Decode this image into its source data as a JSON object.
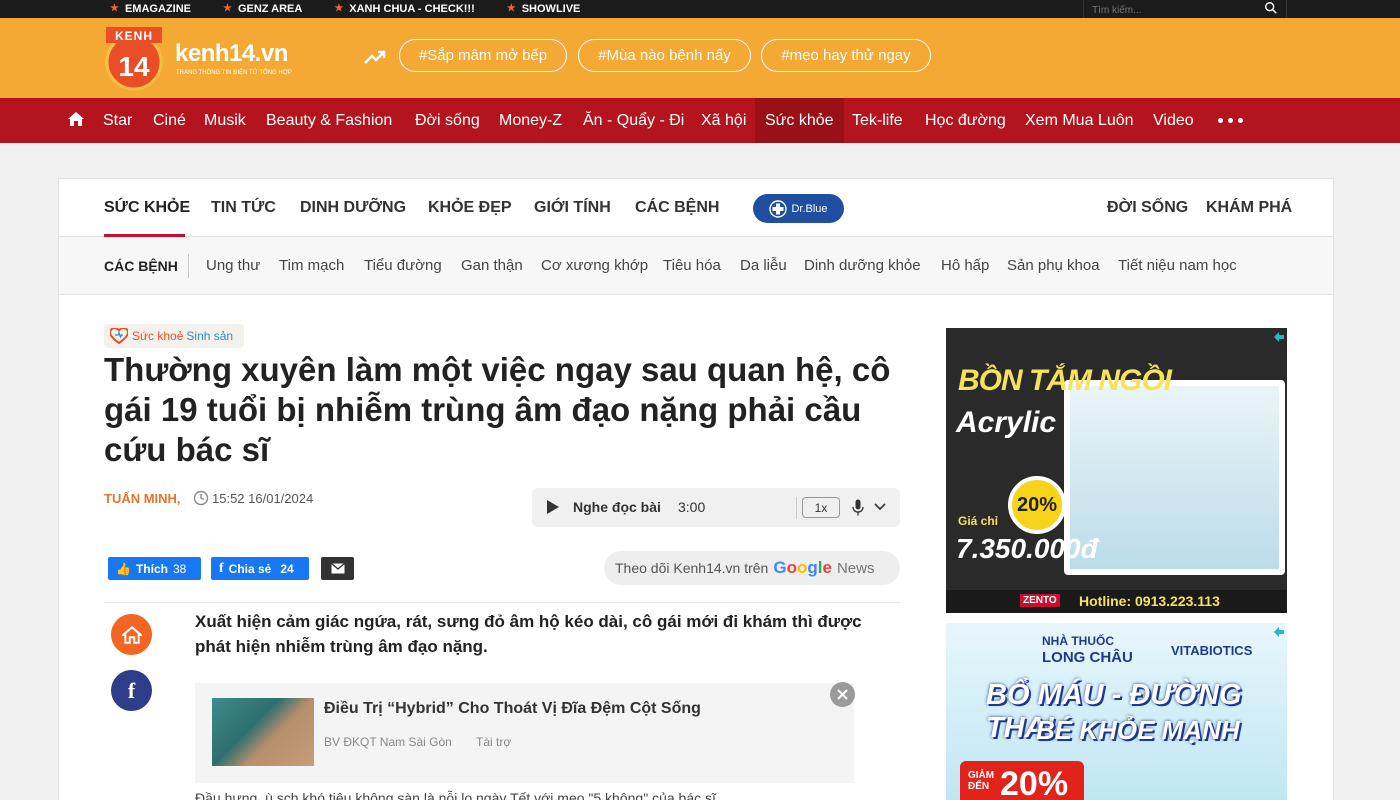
{
  "topbar": {
    "links": [
      "EMAGAZINE",
      "GENZ AREA",
      "XANH CHUA - CHECK!!!",
      "SHOWLIVE"
    ],
    "search_placeholder": "Tìm kiếm..."
  },
  "header": {
    "logo_top": "KENH",
    "logo_num": "14",
    "site_name": "kenh14.vn",
    "site_tagline": "TRANG THÔNG TIN ĐIỆN TỬ TỔNG HỢP",
    "tags": [
      "#Sắp mâm mở bếp",
      "#Mùa nào bệnh nấy",
      "#mẹo hay thử ngay"
    ]
  },
  "mainnav": {
    "items": [
      "Star",
      "Ciné",
      "Musik",
      "Beauty & Fashion",
      "Đời sống",
      "Money-Z",
      "Ăn - Quẩy - Đi",
      "Xã hội",
      "Sức khỏe",
      "Tek-life",
      "Học đường",
      "Xem Mua Luôn",
      "Video"
    ],
    "active": "Sức khỏe"
  },
  "subnav": {
    "items": [
      "SỨC KHỎE",
      "TIN TỨC",
      "DINH DƯỠNG",
      "KHỎE ĐẸP",
      "GIỚI TÍNH",
      "CÁC BỆNH"
    ],
    "drblue": "Dr.Blue",
    "right_items": [
      "ĐỜI SỐNG",
      "KHÁM PHÁ"
    ]
  },
  "catnav": {
    "title": "CÁC BỆNH",
    "items": [
      "Ung thư",
      "Tim mạch",
      "Tiểu đường",
      "Gan thận",
      "Cơ xương khớp",
      "Tiêu hóa",
      "Da liễu",
      "Dinh dưỡng khỏe",
      "Hô hấp",
      "Sản phụ khoa",
      "Tiết niệu nam học"
    ]
  },
  "article": {
    "badge_a": "Sức khoẻ",
    "badge_b": "Sinh sản",
    "title": "Thường xuyên làm một việc ngay sau quan hệ, cô gái 19 tuổi bị nhiễm trùng âm đạo nặng phải cầu cứu bác sĩ",
    "author": "TUẤN MINH,",
    "datetime": "15:52 16/01/2024",
    "audio_label": "Nghe đọc bài",
    "audio_duration": "3:00",
    "audio_speed": "1x",
    "like_label": "Thích",
    "like_count": "38",
    "share_label": "Chia sẻ",
    "share_count": "24",
    "follow_text": "Theo dõi Kenh14.vn trên",
    "google": "Google",
    "news": "News",
    "sapo": "Xuất hiện cảm giác ngứa, rát, sưng đỏ âm hộ kéo dài, cô gái mới đi khám thì được phát hiện nhiễm trùng âm đạo nặng.",
    "sponsor_title": "Điều Trị “Hybrid” Cho Thoát Vị Đĩa Đệm Cột Sống",
    "sponsor_source": "BV ĐKQT Nam Sài Gòn",
    "sponsor_label": "Tài trợ",
    "related": "Đầu hưng, ù sch khó tiêu không sàn là nỗi lo ngày Tết với mẹo \"5 không\" của bác sĩ"
  },
  "ads": {
    "ad1_h1": "BỒN TẮM NGỒI",
    "ad1_h2": "Acrylic",
    "ad1_off": "20%",
    "ad1_price_label": "Giá chỉ",
    "ad1_price": "7.350.000đ",
    "ad1_brand": "ZENTO",
    "ad1_hotline": "Hotline: 0913.223.113",
    "ad2_store": "NHÀ THUỐC",
    "ad2_store_name": "LONG CHÂU",
    "ad2_vita": "VITABIOTICS",
    "ad2_msg1": "BỔ MÁU - ĐƯỜNG THAI",
    "ad2_msg2": "BÉ KHỎE MẠNH",
    "ad2_discount_label": "GIẢM ĐẾN",
    "ad2_discount": "20%"
  },
  "colors": {
    "header_orange": "#f3a933",
    "nav_red": "#b4141e",
    "accent_orange": "#f26522",
    "facebook": "#1877f2"
  }
}
